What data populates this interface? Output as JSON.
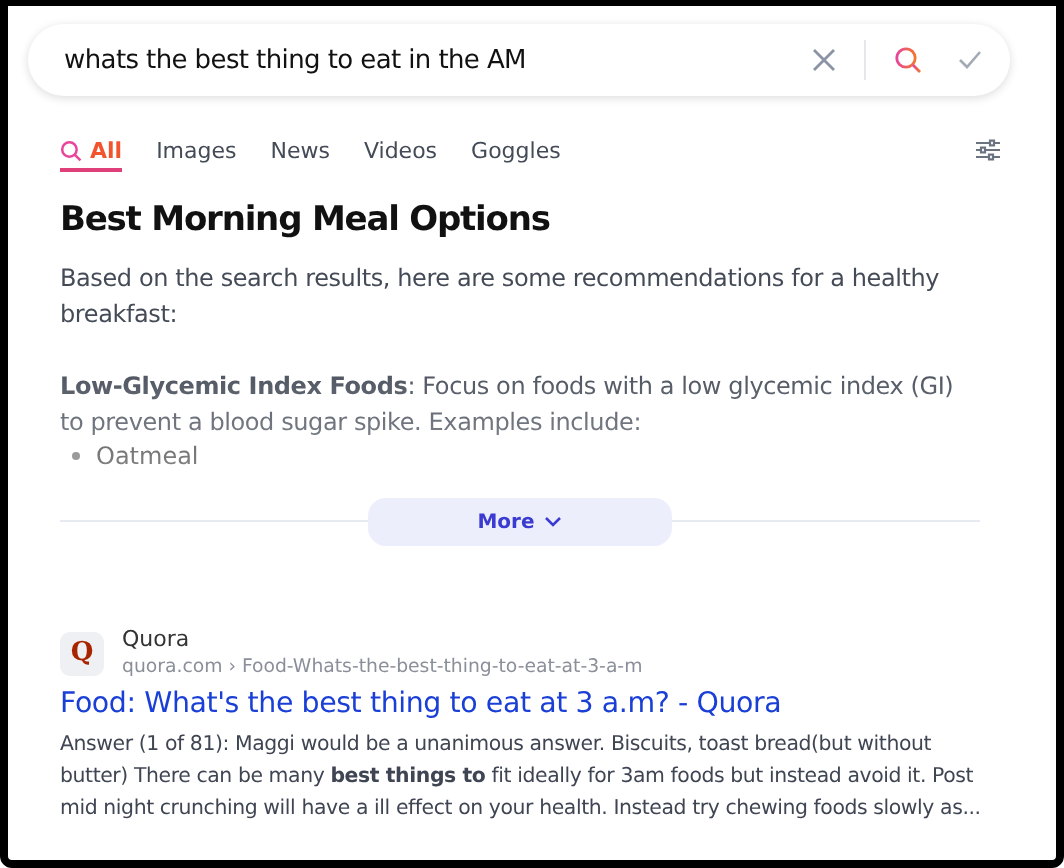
{
  "search": {
    "value": "whats the best thing to eat in the AM"
  },
  "tabs": [
    {
      "label": "All",
      "selected": true,
      "icon": true
    },
    {
      "label": "Images",
      "selected": false
    },
    {
      "label": "News",
      "selected": false
    },
    {
      "label": "Videos",
      "selected": false
    },
    {
      "label": "Goggles",
      "selected": false
    }
  ],
  "answer": {
    "title": "Best Morning Meal Options",
    "intro": "Based on the search results, here are some recommendations for a healthy breakfast:",
    "point": "**Low-Glycemic Index Foods**: Focus on foods with a low glycemic index (GI) to prevent a blood sugar spike. Examples include:",
    "bullets": [
      "Oatmeal"
    ]
  },
  "more_button": {
    "label": "More"
  },
  "result": {
    "favicon": "Q",
    "site": "Quora",
    "url": "quora.com › Food-Whats-the-best-thing-to-eat-at-3-a-m",
    "title": "Food: What's the best thing to eat at 3 a.m? - Quora",
    "snippet": "Answer (1 of 81): Maggi would be a unanimous answer. Biscuits, toast bread(but without butter) There can be many **best things to** fit ideally for 3am foods but instead avoid it. Post mid night crunching will have a ill effect on your health. Instead try chewing foods slowly as..."
  }
}
